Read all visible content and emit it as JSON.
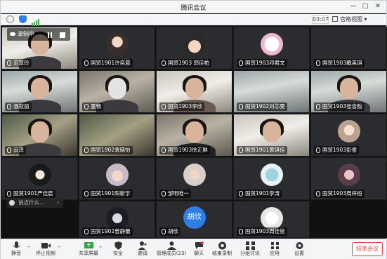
{
  "window": {
    "title": "腾讯会议"
  },
  "infobar": {
    "timer": "03:07",
    "view_mode": "宫格视图"
  },
  "recording": {
    "label": "录制中"
  },
  "chat": {
    "placeholder": "说点什么..."
  },
  "tiles": [
    {
      "name": "范慧玲",
      "kind": "video"
    },
    {
      "name": "国贸1901许奕晨",
      "kind": "avatar"
    },
    {
      "name": "国贸1903  郭佳帕",
      "kind": "avatar"
    },
    {
      "name": "国贸1903邓君文",
      "kind": "avatar"
    },
    {
      "name": "国贸1903戴英琪",
      "kind": "blank"
    },
    {
      "name": "温叙丽",
      "kind": "video"
    },
    {
      "name": "童畅",
      "kind": "video"
    },
    {
      "name": "国贸1903李欣",
      "kind": "video"
    },
    {
      "name": "国贸1902刘芯雯",
      "kind": "video"
    },
    {
      "name": "国贸1903张音韵",
      "kind": "video"
    },
    {
      "name": "云泽",
      "kind": "video"
    },
    {
      "name": "国贸1902袁晓怡",
      "kind": "video"
    },
    {
      "name": "国贸1903徐正琳",
      "kind": "video"
    },
    {
      "name": "国贸1901黄琪佳",
      "kind": "video"
    },
    {
      "name": "国贸1903彭俊",
      "kind": "video"
    },
    {
      "name": "国贸1901严佳宸",
      "kind": "avatar"
    },
    {
      "name": "国贸1901阳新宇",
      "kind": "avatar"
    },
    {
      "name": "邹明唯一",
      "kind": "avatar"
    },
    {
      "name": "国贸1901李涛",
      "kind": "avatar"
    },
    {
      "name": "国贸1903周梓桓",
      "kind": "avatar"
    },
    {
      "name": "国贸1902曾静蕾",
      "kind": "avatar"
    },
    {
      "name": "胡欣",
      "kind": "text-avatar",
      "avatar_text": "胡欣"
    },
    {
      "name": "国贸1903周佳铭",
      "kind": "avatar"
    }
  ],
  "toolbar": {
    "mute": "静音",
    "video": "停止视频",
    "share": "共享屏幕",
    "security": "安全",
    "invite": "邀请",
    "members": "管理成员(23)",
    "chat": "聊天",
    "record": "结束录制",
    "breakout": "分组讨论",
    "apps": "应用",
    "settings": "设置",
    "end": "结束会议"
  },
  "colors": {
    "accent": "#2f7ee6",
    "danger": "#e04848",
    "toolbar_bg": "#f4f5f7",
    "grid_bg": "#111111"
  }
}
